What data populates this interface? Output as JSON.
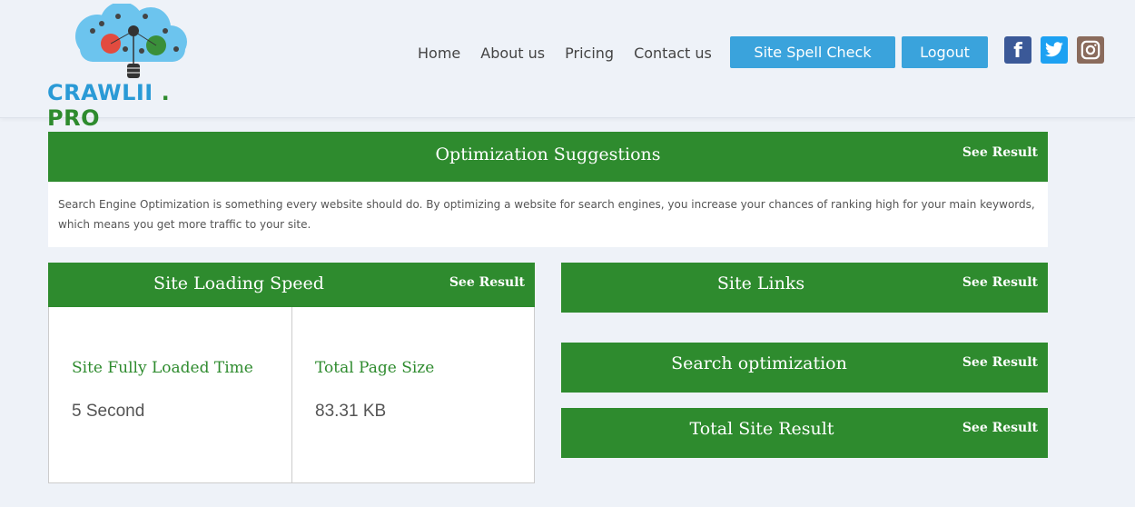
{
  "logo": {
    "text_a": "CRAWLII",
    "text_b": " . PRO"
  },
  "nav": {
    "home": "Home",
    "about": "About us",
    "pricing": "Pricing",
    "contact": "Contact us",
    "spell_check": "Site Spell Check",
    "logout": "Logout"
  },
  "social": {
    "facebook": "f",
    "twitter": "twitter-icon",
    "instagram": "instagram-icon"
  },
  "optimization": {
    "title": "Optimization Suggestions",
    "see_result": "See Result",
    "description": "Search Engine Optimization is something every website should do. By optimizing a website for search engines, you increase your chances of ranking high for your main keywords, which means you get more traffic to your site."
  },
  "speed": {
    "title": "Site Loading Speed",
    "see_result": "See Result",
    "loaded_label": "Site Fully Loaded Time",
    "loaded_value": "5 Second",
    "size_label": "Total Page Size",
    "size_value": "83.31 KB"
  },
  "links": {
    "title": "Site Links",
    "see_result": "See Result"
  },
  "search": {
    "title": "Search optimization",
    "see_result": "See Result"
  },
  "total": {
    "title": "Total Site Result",
    "see_result": "See Result"
  },
  "colors": {
    "green": "#2e8b2e",
    "blue": "#3aa3dc",
    "background": "#eef2f8"
  }
}
